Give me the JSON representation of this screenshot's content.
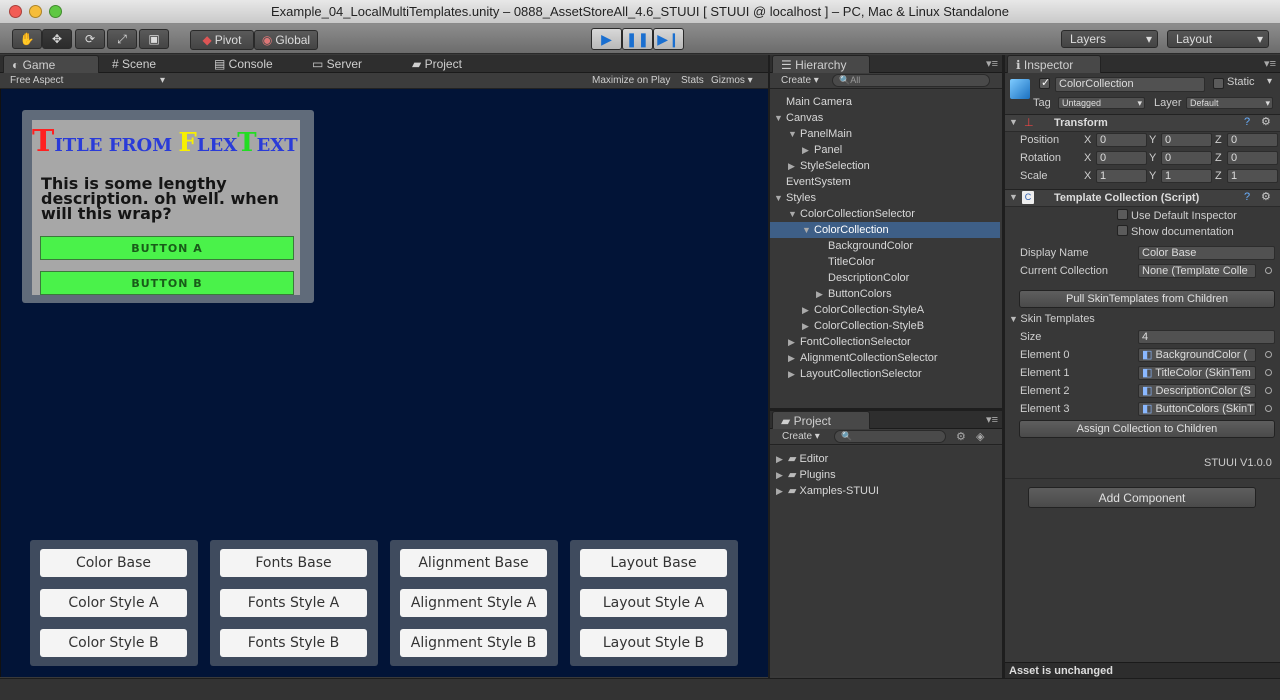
{
  "window_title": "Example_04_LocalMultiTemplates.unity – 0888_AssetStoreAll_4.6_STUUI [ STUUI @ localhost ] – PC, Mac & Linux Standalone",
  "toolbar": {
    "pivot": "Pivot",
    "global": "Global",
    "layers": "Layers",
    "layout": "Layout"
  },
  "tabs": {
    "game": "Game",
    "scene": "Scene",
    "console": "Console",
    "server": "Server",
    "project": "Project"
  },
  "game_bar": {
    "aspect": "Free Aspect",
    "maximize": "Maximize on Play",
    "stats": "Stats",
    "gizmos": "Gizmos"
  },
  "game_panel": {
    "title_letters": [
      "T",
      "ITLE FROM ",
      "F",
      "LEX",
      "T",
      "EXT"
    ],
    "description": "This is some lengthy description. oh well. when will this wrap?",
    "button_a": "BUTTON A",
    "button_b": "BUTTON B"
  },
  "game_button_groups": [
    [
      "Color Base",
      "Color Style A",
      "Color Style B"
    ],
    [
      "Fonts Base",
      "Fonts Style A",
      "Fonts Style B"
    ],
    [
      "Alignment Base",
      "Alignment Style A",
      "Alignment Style B"
    ],
    [
      "Layout Base",
      "Layout Style A",
      "Layout Style B"
    ]
  ],
  "hierarchy": {
    "title": "Hierarchy",
    "create": "Create",
    "search_placeholder": "All",
    "items": [
      {
        "label": "Main Camera",
        "depth": 0,
        "arrow": ""
      },
      {
        "label": "Canvas",
        "depth": 0,
        "arrow": "open"
      },
      {
        "label": "PanelMain",
        "depth": 1,
        "arrow": "open"
      },
      {
        "label": "Panel",
        "depth": 2,
        "arrow": "closed"
      },
      {
        "label": "StyleSelection",
        "depth": 1,
        "arrow": "closed"
      },
      {
        "label": "EventSystem",
        "depth": 0,
        "arrow": ""
      },
      {
        "label": "Styles",
        "depth": 0,
        "arrow": "open"
      },
      {
        "label": "ColorCollectionSelector",
        "depth": 1,
        "arrow": "open"
      },
      {
        "label": "ColorCollection",
        "depth": 2,
        "arrow": "open",
        "selected": true
      },
      {
        "label": "BackgroundColor",
        "depth": 3,
        "arrow": ""
      },
      {
        "label": "TitleColor",
        "depth": 3,
        "arrow": ""
      },
      {
        "label": "DescriptionColor",
        "depth": 3,
        "arrow": ""
      },
      {
        "label": "ButtonColors",
        "depth": 3,
        "arrow": "closed"
      },
      {
        "label": "ColorCollection-StyleA",
        "depth": 2,
        "arrow": "closed"
      },
      {
        "label": "ColorCollection-StyleB",
        "depth": 2,
        "arrow": "closed"
      },
      {
        "label": "FontCollectionSelector",
        "depth": 1,
        "arrow": "closed"
      },
      {
        "label": "AlignmentCollectionSelector",
        "depth": 1,
        "arrow": "closed"
      },
      {
        "label": "LayoutCollectionSelector",
        "depth": 1,
        "arrow": "closed"
      }
    ]
  },
  "project": {
    "title": "Project",
    "create": "Create",
    "folders": [
      "Editor",
      "Plugins",
      "Xamples-STUUI"
    ]
  },
  "inspector": {
    "title": "Inspector",
    "object_name": "ColorCollection",
    "static": "Static",
    "tag_label": "Tag",
    "tag_value": "Untagged",
    "layer_label": "Layer",
    "layer_value": "Default",
    "transform": {
      "header": "Transform",
      "rows": [
        {
          "label": "Position",
          "x": "0",
          "y": "0",
          "z": "0"
        },
        {
          "label": "Rotation",
          "x": "0",
          "y": "0",
          "z": "0"
        },
        {
          "label": "Scale",
          "x": "1",
          "y": "1",
          "z": "1"
        }
      ]
    },
    "script": {
      "header": "Template Collection (Script)",
      "use_default": "Use Default Inspector",
      "show_docs": "Show documentation",
      "display_name_label": "Display Name",
      "display_name": "Color Base",
      "current_collection_label": "Current Collection",
      "current_collection": "None (Template Colle",
      "pull_button": "Pull SkinTemplates from Children",
      "skin_templates": "Skin Templates",
      "size_label": "Size",
      "size": "4",
      "elements": [
        {
          "label": "Element 0",
          "value": "BackgroundColor ("
        },
        {
          "label": "Element 1",
          "value": "TitleColor (SkinTem"
        },
        {
          "label": "Element 2",
          "value": "DescriptionColor (S"
        },
        {
          "label": "Element 3",
          "value": "ButtonColors (SkinT"
        }
      ],
      "assign_button": "Assign Collection to Children",
      "version": "STUUI V1.0.0"
    },
    "add_component": "Add Component",
    "status": "Asset is unchanged"
  }
}
